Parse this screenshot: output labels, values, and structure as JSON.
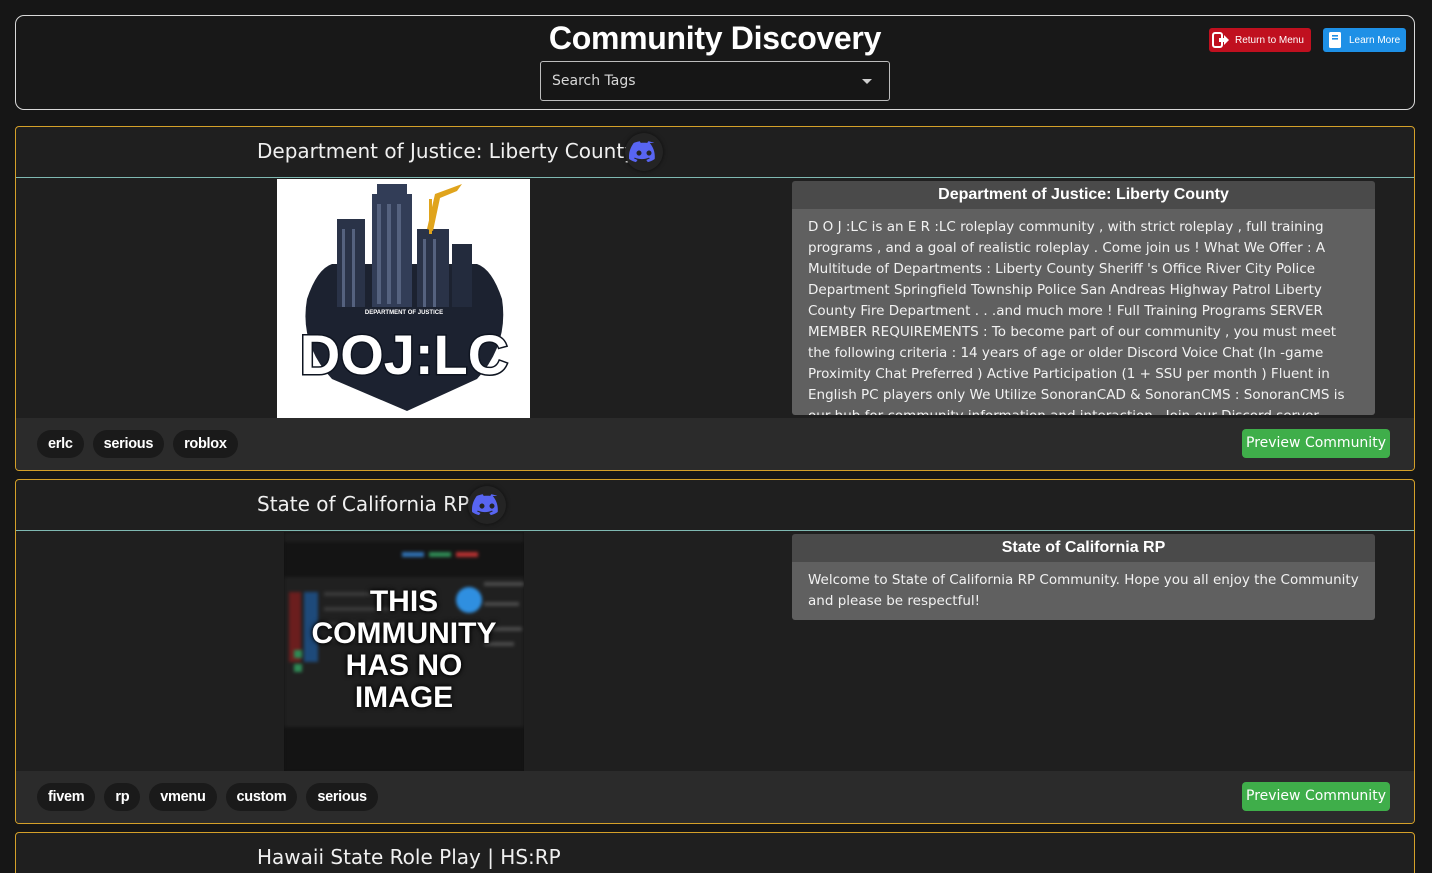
{
  "header": {
    "title": "Community Discovery",
    "search_placeholder": "Search Tags",
    "return_label": "Return to Menu",
    "learn_label": "Learn More"
  },
  "communities": [
    {
      "name": "Department of Justice: Liberty County",
      "description_title": "Department of Justice: Liberty County",
      "description": "D O J :LC is an E R :LC roleplay community , with strict roleplay , full training programs , and a goal of realistic roleplay . Come join us ! What We Offer : A Multitude of Departments : Liberty County Sheriff 's Office River City Police Department Springfield Township Police San Andreas Highway Patrol Liberty County Fire Department . . .and much more ! Full Training Programs SERVER MEMBER REQUIREMENTS : To become part of our community , you must meet the following criteria : 14 years of age or older Discord Voice Chat (In -game Proximity Chat Preferred ) Active Participation (1 + SSU per month ) Fluent in English PC players only We Utilize SonoranCAD & SonoranCMS : SonoranCMS is our hub for community information and interaction . Join our Discord server through the link on the",
      "logo_text": "DOJ:LC",
      "logo_subtext": "DEPARTMENT OF JUSTICE",
      "tags": [
        "erlc",
        "serious",
        "roblox"
      ],
      "preview_label": "Preview Community"
    },
    {
      "name": "State of California RP",
      "description_title": "State of California RP",
      "description": "Welcome to State of California RP Community. Hope you all enjoy the Community and please be respectful!",
      "no_image_text": [
        "THIS",
        "COMMUNITY",
        "HAS NO",
        "IMAGE"
      ],
      "tags": [
        "fivem",
        "rp",
        "vmenu",
        "custom",
        "serious"
      ],
      "preview_label": "Preview Community"
    },
    {
      "name": "Hawaii State Role Play | HS:RP"
    }
  ],
  "colors": {
    "card_border": "#d4a029",
    "preview_green": "#3fae4a",
    "return_red": "#c0101f",
    "learn_blue": "#1e90e6",
    "discord_blurple": "#5865f2"
  },
  "icons": {
    "return": "sign-out-icon",
    "learn": "book-icon",
    "discord": "discord-icon",
    "caret": "chevron-down-icon"
  }
}
